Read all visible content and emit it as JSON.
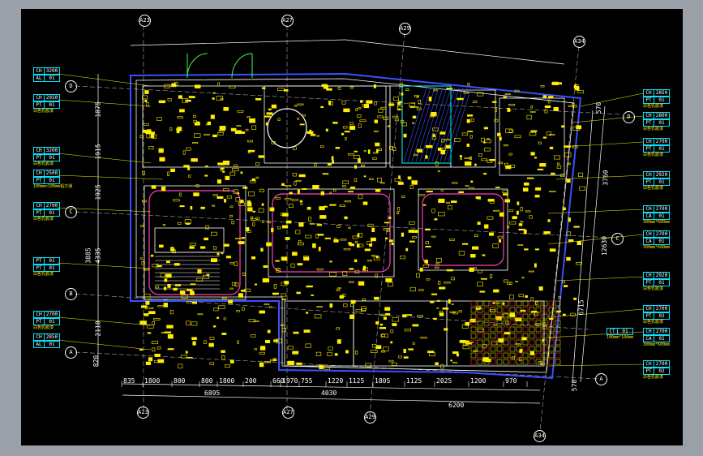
{
  "grid_top": [
    "A23",
    "A27",
    "A29",
    "A34"
  ],
  "grid_bottom": [
    "A23",
    "A27",
    "A29",
    "A34"
  ],
  "row_left": [
    "D",
    "C",
    "B",
    "A"
  ],
  "row_right": [
    "D",
    "C",
    "A"
  ],
  "bottom_dims_row1": [
    "835",
    "1800",
    "800",
    "800",
    "1800",
    "200",
    "660",
    "1970",
    "755",
    "1220",
    "1125",
    "1805",
    "1125",
    "2025",
    "1200",
    "970"
  ],
  "bottom_dims_row2": [
    "6895",
    "4030",
    "6200"
  ],
  "left_dims": [
    "1875",
    "1915",
    "1925",
    "3885",
    "4335",
    "2110",
    "820"
  ],
  "right_dims": [
    "570",
    "3760",
    "12630",
    "6715",
    "570"
  ],
  "left_tags": [
    {
      "k1": "CH",
      "v1": "3200",
      "k2": "AL",
      "v2": "01",
      "n": ""
    },
    {
      "k1": "CH",
      "v1": "2950",
      "k2": "PT",
      "v2": "01",
      "n": "白色乳胶漆"
    },
    {
      "k1": "CH",
      "v1": "3200",
      "k2": "PT",
      "v2": "01",
      "n": "白色乳胶漆"
    },
    {
      "k1": "CH",
      "v1": "2500",
      "k2": "PT",
      "v2": "01",
      "n": "100mm×100mm铝方通"
    },
    {
      "k1": "CH",
      "v1": "2700",
      "k2": "PT",
      "v2": "01",
      "n": "白色乳胶漆"
    },
    {
      "k1": "PT",
      "v1": "01",
      "k2": "PT",
      "v2": "01",
      "n": "白色乳胶漆"
    },
    {
      "k1": "CH",
      "v1": "2700",
      "k2": "PT",
      "v2": "01",
      "n": "白色乳胶漆"
    },
    {
      "k1": "CH",
      "v1": "2850",
      "k2": "AL",
      "v2": "01",
      "n": ""
    }
  ],
  "right_tags": [
    {
      "k1": "CH",
      "v1": "2850",
      "k2": "PT",
      "v2": "01",
      "n": "白色乳胶漆"
    },
    {
      "k1": "CH",
      "v1": "2800",
      "k2": "PT",
      "v2": "01",
      "n": "白色乳胶漆"
    },
    {
      "k1": "CH",
      "v1": "2700",
      "k2": "PT",
      "v2": "01",
      "n": "白色乳胶漆"
    },
    {
      "k1": "CH",
      "v1": "2920",
      "k2": "PT",
      "v2": "01",
      "n": "白色乳胶漆"
    },
    {
      "k1": "CH",
      "v1": "2700",
      "k2": "CA",
      "v2": "01",
      "n": "300mm*600mm"
    },
    {
      "k1": "CH",
      "v1": "2700",
      "k2": "CA",
      "v2": "01",
      "n": "300mm*600mm"
    },
    {
      "k1": "CH",
      "v1": "2920",
      "k2": "PT",
      "v2": "01",
      "n": "白色乳胶漆"
    },
    {
      "k1": "CH",
      "v1": "2700",
      "k2": "PT",
      "v2": "02",
      "n": "白色乳胶漆"
    },
    {
      "k1": "CH",
      "v1": "2700",
      "k2": "CA",
      "v2": "01",
      "n": "300mm*600mm"
    },
    {
      "k1": "CH",
      "v1": "2700",
      "k2": "PT",
      "v2": "02",
      "n": "白色乳胶漆"
    }
  ],
  "ct_tag": {
    "k": "CT",
    "v": "01",
    "n": "100mm*100mm"
  }
}
